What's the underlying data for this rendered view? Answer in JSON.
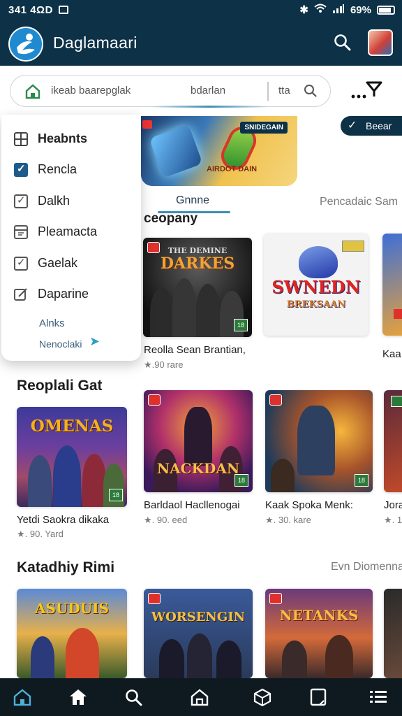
{
  "status_bar": {
    "time": "341 4ΩD",
    "battery": "69%"
  },
  "app_bar": {
    "title": "Daglamaari"
  },
  "search": {
    "placeholder": "ikeab baarepglak",
    "secondary": "bdarlan",
    "suffix": "tta"
  },
  "banner": {
    "tag": "SNIDEGAIN",
    "subtitle": "AIRDOT DAIN"
  },
  "pill_button": {
    "label": "Beear"
  },
  "tabs": {
    "active": "Gnnne",
    "right": "Pencadaic Sam"
  },
  "company_heading": "ceopany",
  "menu": {
    "items": [
      {
        "label": "Heabnts",
        "icon": "grid-icon"
      },
      {
        "label": "Rencla",
        "icon": "checked-box-icon"
      },
      {
        "label": "Dalkh",
        "icon": "checkbox-icon"
      },
      {
        "label": "Pleamacta",
        "icon": "calendar-icon"
      },
      {
        "label": "Gaelak",
        "icon": "checkbox-icon"
      },
      {
        "label": "Daparine",
        "icon": "edit-icon"
      }
    ],
    "footer_line1": "Alnks",
    "footer_line2": "Nenoclaki"
  },
  "row1": [
    {
      "card_text": "DARKES",
      "card_top": "THE DEMINE",
      "title": "Reolla Sean Brantian,",
      "rating": "★.90 rare"
    },
    {
      "card_text": "SWNEDN",
      "card_sub": "BREKSAAN",
      "title": "",
      "rating": ""
    },
    {
      "card_text": "",
      "title": "Kaa",
      "rating": ""
    }
  ],
  "section2": {
    "heading": "Reoplali Gat"
  },
  "row2": [
    {
      "card_text": "OMENAS",
      "title": "Yetdi Saokra dikaka",
      "rating": "★. 90. Yard"
    },
    {
      "card_text": "NACKDAN",
      "title": "Barldaol Hacllenogai",
      "rating": "★. 90. eed"
    },
    {
      "card_text": "",
      "title": "Kaak Spoka Menk:",
      "rating": "★. 30. kare"
    },
    {
      "card_text": "",
      "title": "Jora",
      "rating": "★. 1"
    }
  ],
  "section3": {
    "heading": "Katadhiy Rimi",
    "right": "Evn Diomenna"
  },
  "row3": [
    {
      "card_text": "ASUDUIS"
    },
    {
      "card_text": "WORSENGIN"
    },
    {
      "card_text": "NETANKS"
    },
    {
      "card_text": ""
    }
  ],
  "bottom_nav": [
    "home-outline-icon",
    "home-icon",
    "search-icon",
    "house-icon",
    "cube-icon",
    "bookmark-icon",
    "list-icon"
  ],
  "colors": {
    "primary": "#0d3147",
    "accent": "#3d8fb5",
    "nav_bg": "#0f1a20"
  }
}
